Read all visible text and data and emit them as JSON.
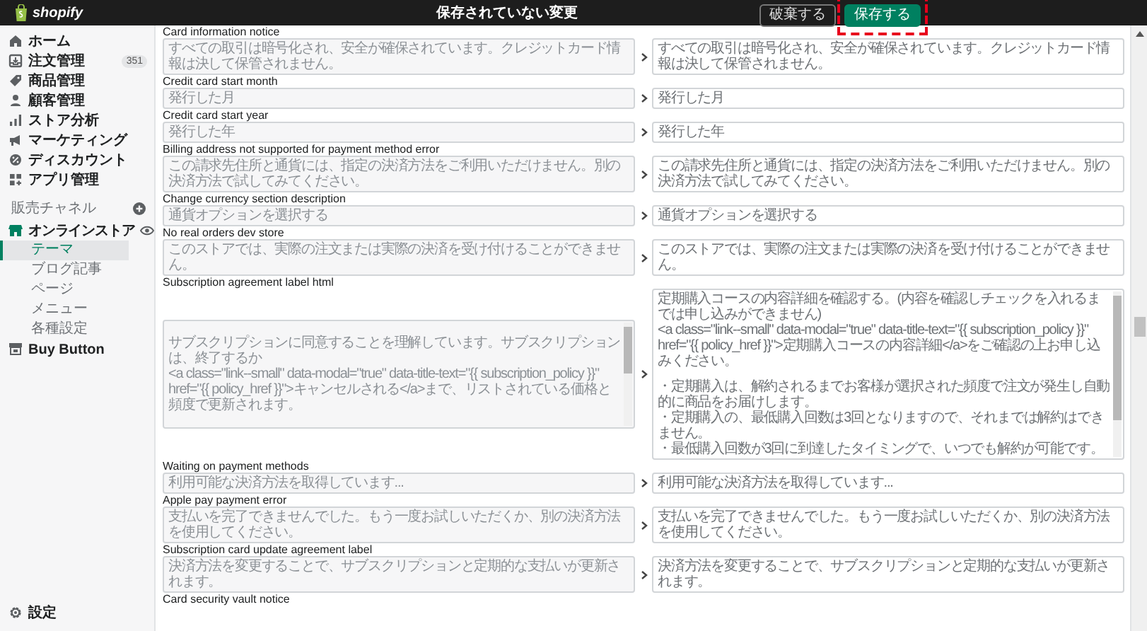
{
  "top_bar": {
    "logo": "shopify",
    "title": "保存されていない変更",
    "buttons": [
      {
        "label": "破棄する",
        "kind": "secondary",
        "highlighted": false
      },
      {
        "label": "保存する",
        "kind": "primary",
        "highlighted": true
      }
    ]
  },
  "sidebar": {
    "items": [
      {
        "label": "ホーム"
      },
      {
        "label": "注文管理",
        "badge": "351"
      },
      {
        "label": "商品管理"
      },
      {
        "label": "顧客管理"
      },
      {
        "label": "ストア分析"
      },
      {
        "label": "マーケティング"
      },
      {
        "label": "ディスカウント"
      },
      {
        "label": "アプリ管理"
      }
    ],
    "section": {
      "title": "販売チャネル"
    },
    "channel": {
      "label": "オンラインストア",
      "children": [
        {
          "label": "テーマ",
          "selected": true
        },
        {
          "label": "ブログ記事",
          "selected": false
        },
        {
          "label": "ページ",
          "selected": false
        },
        {
          "label": "メニュー",
          "selected": false
        },
        {
          "label": "各種設定",
          "selected": false
        }
      ]
    },
    "buy_button": {
      "label": "Buy Button"
    },
    "settings": {
      "label": "設定"
    }
  },
  "rows": [
    {
      "kind": "text",
      "label": "Card information notice",
      "source": {
        "placeholder": "すべての取引は暗号化され、安全が確保されています。クレジットカード情報は決して保管されません。"
      },
      "translation": {
        "value": "すべての取引は暗号化され、安全が確保されています。クレジットカード情報は決して保管されません。"
      }
    },
    {
      "kind": "text",
      "label": "Credit card start month",
      "source": {
        "placeholder": "発行した月"
      },
      "translation": {
        "value": "発行した月"
      }
    },
    {
      "kind": "text",
      "label": "Credit card start year",
      "source": {
        "placeholder": "発行した年"
      },
      "translation": {
        "value": "発行した年"
      }
    },
    {
      "kind": "text",
      "label": "Billing address not supported for payment method error",
      "source": {
        "placeholder": "この請求先住所と通貨には、指定の決済方法をご利用いただけません。別の決済方法で試してみてください。"
      },
      "translation": {
        "value": "この請求先住所と通貨には、指定の決済方法をご利用いただけません。別の決済方法で試してみてください。"
      }
    },
    {
      "kind": "text",
      "label": "Change currency section description",
      "source": {
        "placeholder": "通貨オプションを選択する"
      },
      "translation": {
        "value": "通貨オプションを選択する"
      }
    },
    {
      "kind": "text",
      "label": "No real orders dev store",
      "source": {
        "placeholder": "このストアでは、実際の注文または実際の決済を受け付けることができません。"
      },
      "translation": {
        "value": "このストアでは、実際の注文または実際の決済を受け付けることができません。"
      }
    },
    {
      "kind": "textarea",
      "label": "Subscription agreement label html",
      "source": {
        "placeholder_paragraphs": [
          [
            "サブスクリプションに同意することを理解しています。サブスクリプションは、終了するか",
            "<a class=\"link--small\" data-modal=\"true\" data-title-text=\"{{ subscription_policy }}\" href=\"{{ policy_href }}\">キャンセルされる</a>まで、リストされている価格と頻度で更新されます。"
          ]
        ]
      },
      "translation": {
        "paragraphs": [
          [
            "定期購入コースの内容詳細を確認する。(内容を確認しチェックを入れるまでは申し込みができません)",
            "<a class=\"link--small\" data-modal=\"true\" data-title-text=\"{{ subscription_policy }}\" href=\"{{ policy_href }}\">定期購入コースの内容詳細</a>をご確認の上お申し込みください。"
          ],
          [
            "・定期購入は、解約されるまでお客様が選択された頻度で注文が発生し自動的に商品をお届けします。",
            "・定期購入の、最低購入回数は3回となりますので、それまでは解約はできません。",
            "・最低購入回数が3回に到達したタイミングで、いつでも解約が可能です。"
          ]
        ]
      }
    },
    {
      "kind": "text",
      "label": "Waiting on payment methods",
      "source": {
        "placeholder": "利用可能な決済方法を取得しています..."
      },
      "translation": {
        "value": "利用可能な決済方法を取得しています..."
      }
    },
    {
      "kind": "text",
      "label": "Apple pay payment error",
      "source": {
        "placeholder": "支払いを完了できませんでした。もう一度お試しいただくか、別の決済方法を使用してください。"
      },
      "translation": {
        "value": "支払いを完了できませんでした。もう一度お試しいただくか、別の決済方法を使用してください。"
      }
    },
    {
      "kind": "text",
      "label": "Subscription card update agreement label",
      "source": {
        "placeholder": "決済方法を変更することで、サブスクリプションと定期的な支払いが更新されます。"
      },
      "translation": {
        "value": "決済方法を変更することで、サブスクリプションと定期的な支払いが更新されます。"
      }
    },
    {
      "kind": "label_only",
      "label": "Card security vault notice"
    }
  ]
}
